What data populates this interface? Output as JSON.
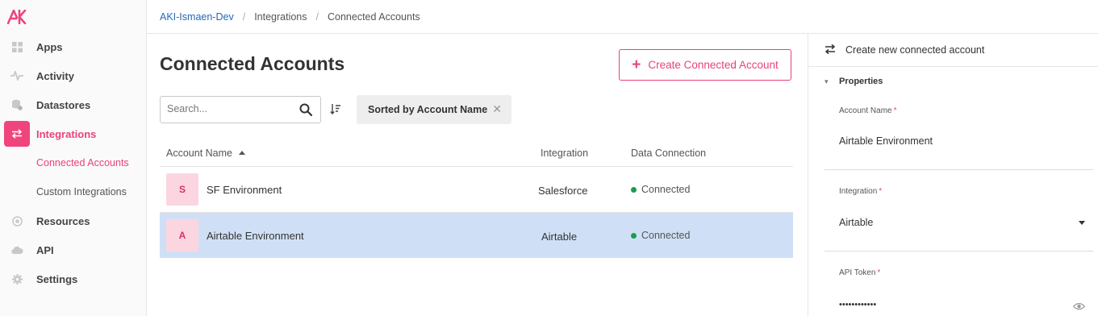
{
  "colors": {
    "accent": "#e8437a",
    "selected_row": "#cfe0f6",
    "status_green": "#1a9c4e",
    "link": "#2468b8"
  },
  "sidebar": {
    "items": [
      {
        "label": "Apps",
        "icon": "apps-grid-icon"
      },
      {
        "label": "Activity",
        "icon": "activity-pulse-icon"
      },
      {
        "label": "Datastores",
        "icon": "database-icon"
      },
      {
        "label": "Integrations",
        "icon": "swap-arrows-icon",
        "active": true
      },
      {
        "label": "Resources",
        "icon": "resources-icon"
      },
      {
        "label": "API",
        "icon": "cloud-icon"
      },
      {
        "label": "Settings",
        "icon": "gear-icon"
      }
    ],
    "subitems": [
      {
        "label": "Connected Accounts",
        "active": true
      },
      {
        "label": "Custom Integrations"
      }
    ]
  },
  "breadcrumb": [
    "AKI-Ismaen-Dev",
    "Integrations",
    "Connected Accounts"
  ],
  "page": {
    "title": "Connected Accounts",
    "create_button": "Create Connected Account",
    "search_placeholder": "Search...",
    "sort_chip": "Sorted by Account Name"
  },
  "table": {
    "headers": [
      "Account Name",
      "Integration",
      "Data Connection"
    ],
    "rows": [
      {
        "initial": "S",
        "name": "SF Environment",
        "integration": "Salesforce",
        "status": "Connected"
      },
      {
        "initial": "A",
        "name": "Airtable Environment",
        "integration": "Airtable",
        "status": "Connected",
        "selected": true
      }
    ]
  },
  "panel": {
    "title": "Create new connected account",
    "section": "Properties",
    "fields": [
      {
        "label": "Account Name",
        "required": true,
        "value": "Airtable Environment"
      },
      {
        "label": "Integration",
        "required": true,
        "value": "Airtable"
      },
      {
        "label": "API Token",
        "required": true,
        "value": "••••••••••••"
      }
    ]
  }
}
